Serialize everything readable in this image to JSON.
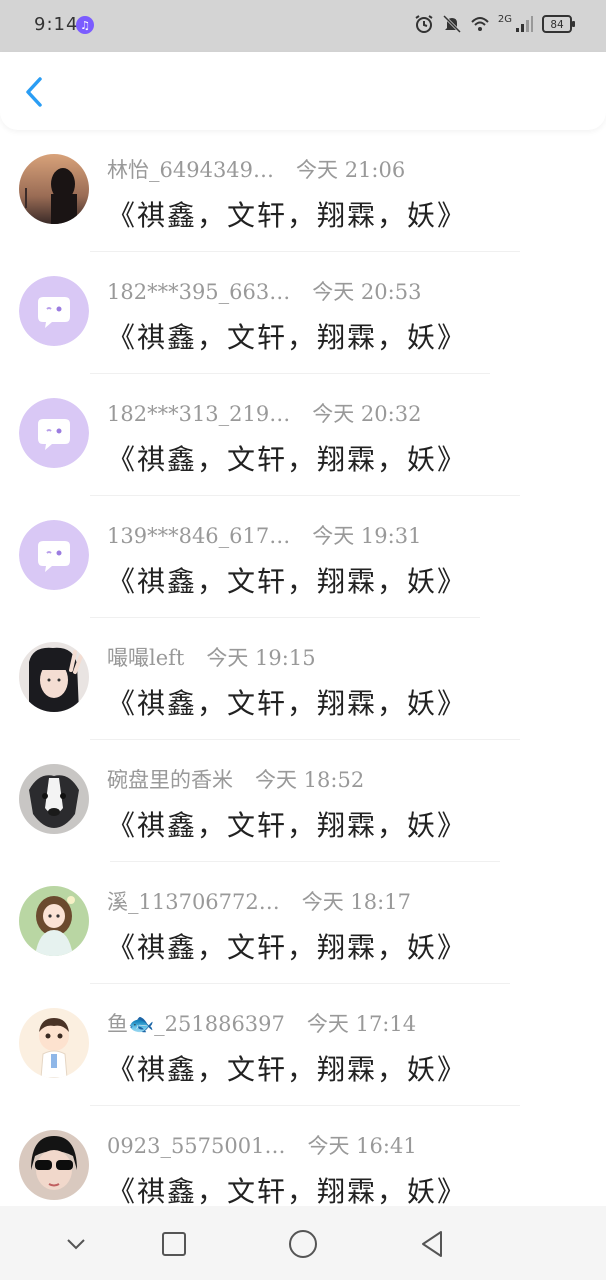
{
  "status_bar": {
    "time": "9:14",
    "network": "2G",
    "battery": "84",
    "icons": [
      "music-app-icon",
      "alarm-icon",
      "mute-icon",
      "wifi-icon",
      "signal-icon",
      "battery-icon"
    ]
  },
  "header": {
    "back_icon": "chevron-left-icon",
    "accent_color": "#2a9df4"
  },
  "messages": [
    {
      "name": "林怡_6494349…",
      "time": "今天 21:06",
      "text": "《祺鑫，文轩，翔霖，妖》",
      "avatar": "photo-girl-sunset"
    },
    {
      "name": "182***395_663…",
      "time": "今天 20:53",
      "text": "《祺鑫，文轩，翔霖，妖》",
      "avatar": "default-purple-chat"
    },
    {
      "name": "182***313_219…",
      "time": "今天 20:32",
      "text": "《祺鑫，文轩，翔霖，妖》",
      "avatar": "default-purple-chat"
    },
    {
      "name": "139***846_617…",
      "time": "今天 19:31",
      "text": "《祺鑫，文轩，翔霖，妖》",
      "avatar": "default-purple-chat"
    },
    {
      "name": "嘬嘬left",
      "time": "今天 19:15",
      "text": "《祺鑫，文轩，翔霖，妖》",
      "avatar": "photo-girl-peace"
    },
    {
      "name": "碗盘里的香米",
      "time": "今天 18:52",
      "text": "《祺鑫，文轩，翔霖，妖》",
      "avatar": "photo-dog"
    },
    {
      "name": "溪_113706772…",
      "time": "今天 18:17",
      "text": "《祺鑫，文轩，翔霖，妖》",
      "avatar": "illustration-girl-green"
    },
    {
      "name": "鱼🐟_251886397",
      "time": "今天 17:14",
      "text": "《祺鑫，文轩，翔霖，妖》",
      "avatar": "illustration-boy-cartoon"
    },
    {
      "name": "0923_5575001…",
      "time": "今天 16:41",
      "text": "《祺鑫，文轩，翔霖，妖》",
      "avatar": "photo-sunglasses"
    }
  ],
  "nav": {
    "icons": [
      "chevron-down-icon",
      "recents-square-icon",
      "home-circle-icon",
      "back-triangle-icon"
    ]
  }
}
